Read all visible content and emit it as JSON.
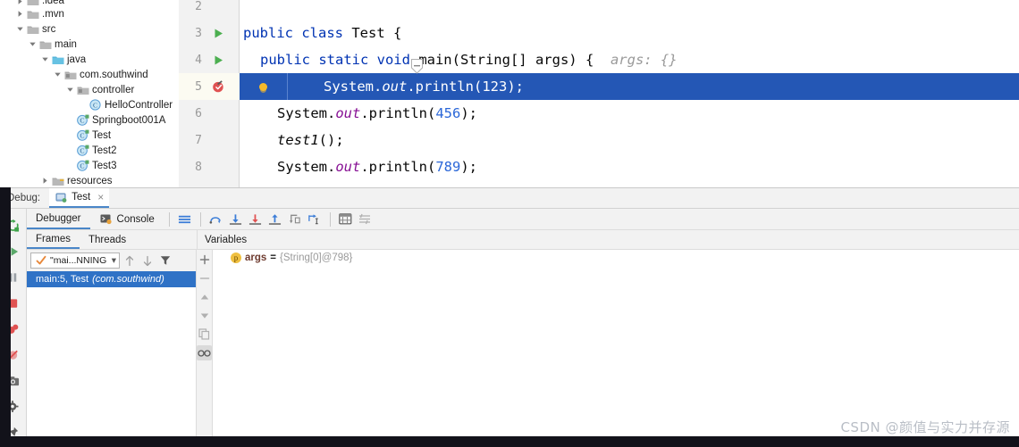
{
  "project_tree": {
    "items": [
      {
        "label": ".idea",
        "indent": 1,
        "twisty": "right",
        "icon": "folder-icon",
        "clipped_top": true
      },
      {
        "label": ".mvn",
        "indent": 1,
        "twisty": "right",
        "icon": "folder-icon"
      },
      {
        "label": "src",
        "indent": 1,
        "twisty": "down",
        "icon": "folder-icon"
      },
      {
        "label": "main",
        "indent": 2,
        "twisty": "down",
        "icon": "folder-icon"
      },
      {
        "label": "java",
        "indent": 3,
        "twisty": "down",
        "icon": "folder-source-icon"
      },
      {
        "label": "com.southwind",
        "indent": 4,
        "twisty": "down",
        "icon": "package-icon"
      },
      {
        "label": "controller",
        "indent": 5,
        "twisty": "down",
        "icon": "package-icon"
      },
      {
        "label": "HelloController",
        "indent": 6,
        "twisty": "none",
        "icon": "class-icon"
      },
      {
        "label": "Springboot001A",
        "indent": 5,
        "twisty": "none",
        "icon": "class-runnable-icon"
      },
      {
        "label": "Test",
        "indent": 5,
        "twisty": "none",
        "icon": "class-runnable-icon"
      },
      {
        "label": "Test2",
        "indent": 5,
        "twisty": "none",
        "icon": "class-runnable-icon"
      },
      {
        "label": "Test3",
        "indent": 5,
        "twisty": "none",
        "icon": "class-runnable-icon"
      },
      {
        "label": "resources",
        "indent": 3,
        "twisty": "right",
        "icon": "folder-resources-icon"
      }
    ]
  },
  "editor": {
    "lines": [
      {
        "number": "2",
        "gutter_icon": "none",
        "selected": false,
        "indent": 0,
        "tokens": []
      },
      {
        "number": "3",
        "gutter_icon": "run-arrow-icon",
        "selected": false,
        "indent": 0,
        "tokens": [
          {
            "t": "public class ",
            "c": "kw"
          },
          {
            "t": "Test {",
            "c": "plain"
          }
        ]
      },
      {
        "number": "4",
        "gutter_icon": "run-arrow-icon",
        "selected": false,
        "indent": 1,
        "tokens": [
          {
            "t": "public static void ",
            "c": "kw"
          },
          {
            "t": "main",
            "c": "plain"
          },
          {
            "t": "(String[] args) {",
            "c": "plain"
          },
          {
            "t": "  args: {}",
            "c": "hint"
          }
        ]
      },
      {
        "number": "5",
        "gutter_icon": "breakpoint-verified-icon",
        "selected": true,
        "indent": 2,
        "tokens": [
          {
            "t": "System.",
            "c": "plain"
          },
          {
            "t": "out",
            "c": "fieldi"
          },
          {
            "t": ".println(",
            "c": "plain"
          },
          {
            "t": "123",
            "c": "num-lit"
          },
          {
            "t": ");",
            "c": "plain"
          }
        ]
      },
      {
        "number": "6",
        "gutter_icon": "none",
        "selected": false,
        "indent": 2,
        "tokens": [
          {
            "t": "System.",
            "c": "plain"
          },
          {
            "t": "out",
            "c": "fieldi"
          },
          {
            "t": ".println(",
            "c": "plain"
          },
          {
            "t": "456",
            "c": "num-lit"
          },
          {
            "t": ");",
            "c": "plain"
          }
        ]
      },
      {
        "number": "7",
        "gutter_icon": "none",
        "selected": false,
        "indent": 2,
        "tokens": [
          {
            "t": "test1",
            "c": "methi"
          },
          {
            "t": "();",
            "c": "plain"
          }
        ]
      },
      {
        "number": "8",
        "gutter_icon": "none",
        "selected": false,
        "indent": 2,
        "tokens": [
          {
            "t": "System.",
            "c": "plain"
          },
          {
            "t": "out",
            "c": "fieldi"
          },
          {
            "t": ".println(",
            "c": "plain"
          },
          {
            "t": "789",
            "c": "num-lit"
          },
          {
            "t": ");",
            "c": "plain"
          }
        ]
      }
    ]
  },
  "debug": {
    "tabstrip": {
      "label": "Debug:",
      "run_tab": {
        "name": "Test",
        "close": "×",
        "icon": "run-config-icon"
      }
    },
    "left_strip": [
      {
        "name": "rerun-button",
        "icon": "rerun-icon"
      },
      {
        "name": "resume-program-button",
        "icon": "resume-icon"
      },
      {
        "name": "pause-program-button",
        "icon": "pause-icon"
      },
      {
        "name": "stop-button",
        "icon": "stop-icon"
      },
      {
        "name": "view-breakpoints-button",
        "icon": "breakpoints-icon"
      },
      {
        "name": "mute-breakpoints-button",
        "icon": "mute-breakpoints-icon"
      },
      {
        "name": "screenshot-button",
        "icon": "camera-icon"
      },
      {
        "name": "settings-button",
        "icon": "gear-icon"
      },
      {
        "name": "pin-button",
        "icon": "pin-icon"
      }
    ],
    "toolbar": {
      "tabs": [
        {
          "label": "Debugger",
          "active": true,
          "icon": "none"
        },
        {
          "label": "Console",
          "active": false,
          "icon": "console-icon"
        }
      ],
      "buttons": [
        {
          "name": "show-execution-point-button",
          "icon": "execution-point-icon"
        },
        {
          "name": "step-over-button",
          "icon": "step-over-icon"
        },
        {
          "name": "step-into-button",
          "icon": "step-into-icon"
        },
        {
          "name": "force-step-into-button",
          "icon": "force-step-into-icon"
        },
        {
          "name": "step-out-button",
          "icon": "step-out-icon"
        },
        {
          "name": "drop-frame-button",
          "icon": "drop-frame-icon"
        },
        {
          "name": "run-to-cursor-button",
          "icon": "run-to-cursor-icon"
        },
        {
          "name": "evaluate-expression-button",
          "icon": "evaluate-icon"
        },
        {
          "name": "settings-button",
          "icon": "layout-settings-icon"
        }
      ]
    },
    "frames": {
      "tabs": [
        {
          "label": "Frames",
          "active": true
        },
        {
          "label": "Threads",
          "active": false
        }
      ],
      "thread_selector": {
        "value": "\"mai...NNING",
        "icon": "thread-running-icon",
        "chevron": "▾"
      },
      "toolbar_buttons": [
        {
          "name": "move-frame-up-button",
          "icon": "arrow-up-icon"
        },
        {
          "name": "move-frame-down-button",
          "icon": "arrow-down-icon"
        },
        {
          "name": "filter-frames-button",
          "icon": "filter-icon"
        }
      ],
      "rows": [
        {
          "method": "main:5, Test",
          "package": "(com.southwind)",
          "selected": true
        }
      ]
    },
    "frames_side_buttons": [
      {
        "name": "add-watch-button",
        "icon": "plus-icon",
        "pressed": false
      },
      {
        "name": "remove-watch-button",
        "icon": "minus-icon",
        "pressed": false
      },
      {
        "name": "move-up-button",
        "icon": "triangle-up-icon",
        "pressed": false
      },
      {
        "name": "move-down-button",
        "icon": "triangle-down-icon",
        "pressed": false
      },
      {
        "name": "copy-value-button",
        "icon": "copy-icon",
        "pressed": false
      },
      {
        "name": "inspect-button",
        "icon": "glasses-icon",
        "pressed": true
      }
    ],
    "variables": {
      "header": "Variables",
      "rows": [
        {
          "badge": "p",
          "name": "args",
          "eq": "=",
          "value": "{String[0]@798}"
        }
      ]
    }
  },
  "watermark": {
    "text": "CSDN @颜值与实力并存源"
  },
  "colors": {
    "selection_blue": "#2457b5",
    "frame_selected_blue": "#2f72c6",
    "keyword_blue": "#0033b3",
    "number_blue": "#2b67d8",
    "field_purple": "#871094",
    "breakpoint_red": "#e05252",
    "run_green": "#4caf50",
    "breakpoint_dot_yellow": "#f5ba2b",
    "panel_gray": "#f2f2f2",
    "tab_underline": "#4a86c8"
  }
}
